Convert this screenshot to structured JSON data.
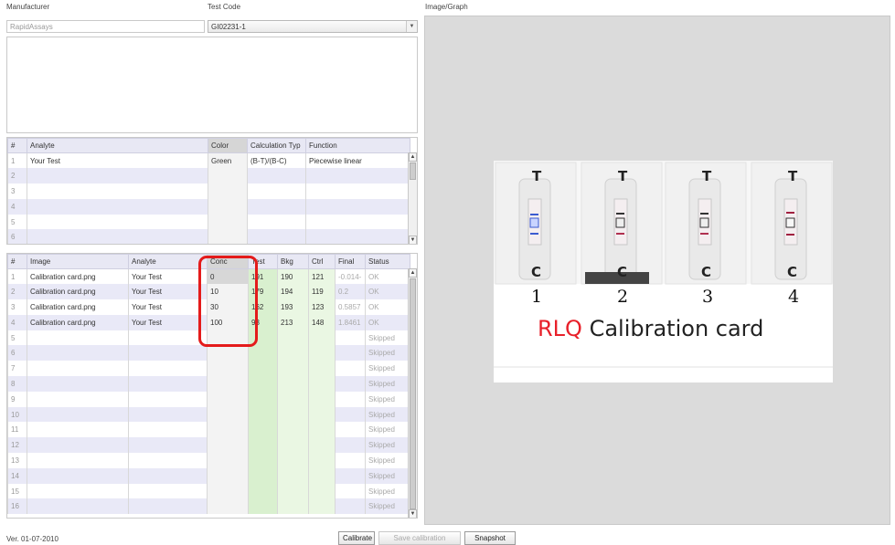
{
  "form": {
    "manufacturer_label": "Manufacturer",
    "manufacturer_value": "RapidAssays",
    "test_code_label": "Test Code",
    "test_code_value": "GI02231-1",
    "image_graph_label": "Image/Graph"
  },
  "analyte_table": {
    "headers": [
      "#",
      "Analyte",
      "Color",
      "Calculation Typ",
      "Function"
    ],
    "rows": [
      {
        "n": "1",
        "analyte": "Your Test",
        "color": "Green",
        "calc": "(B-T)/(B-C)",
        "func": "Piecewise linear"
      },
      {
        "n": "2"
      },
      {
        "n": "3"
      },
      {
        "n": "4"
      },
      {
        "n": "5"
      },
      {
        "n": "6"
      }
    ]
  },
  "image_table": {
    "headers": [
      "#",
      "Image",
      "Analyte",
      "Conc",
      "Test",
      "Bkg",
      "Ctrl",
      "Final",
      "Status"
    ],
    "rows": [
      {
        "n": "1",
        "image": "Calibration card.png",
        "analyte": "Your Test",
        "conc": "0",
        "test": "191",
        "bkg": "190",
        "ctrl": "121",
        "final": "-0.014-",
        "status": "OK"
      },
      {
        "n": "2",
        "image": "Calibration card.png",
        "analyte": "Your Test",
        "conc": "10",
        "test": "179",
        "bkg": "194",
        "ctrl": "119",
        "final": "0.2",
        "status": "OK"
      },
      {
        "n": "3",
        "image": "Calibration card.png",
        "analyte": "Your Test",
        "conc": "30",
        "test": "162",
        "bkg": "193",
        "ctrl": "123",
        "final": "0.5857",
        "status": "OK"
      },
      {
        "n": "4",
        "image": "Calibration card.png",
        "analyte": "Your Test",
        "conc": "100",
        "test": "93",
        "bkg": "213",
        "ctrl": "148",
        "final": "1.8461",
        "status": "OK"
      },
      {
        "n": "5",
        "status": "Skipped"
      },
      {
        "n": "6",
        "status": "Skipped"
      },
      {
        "n": "7",
        "status": "Skipped"
      },
      {
        "n": "8",
        "status": "Skipped"
      },
      {
        "n": "9",
        "status": "Skipped"
      },
      {
        "n": "10",
        "status": "Skipped"
      },
      {
        "n": "11",
        "status": "Skipped"
      },
      {
        "n": "12",
        "status": "Skipped"
      },
      {
        "n": "13",
        "status": "Skipped"
      },
      {
        "n": "14",
        "status": "Skipped"
      },
      {
        "n": "15",
        "status": "Skipped"
      },
      {
        "n": "16",
        "status": "Skipped"
      }
    ]
  },
  "calibration_card": {
    "strip_numbers": [
      "1",
      "2",
      "3",
      "4"
    ],
    "title_red": "RLQ",
    "title_rest": " Calibration card",
    "strip_top_letter": "T",
    "strip_bottom_letter": "C"
  },
  "footer": {
    "version": "Ver. 01-07-2010",
    "calibrate_label": "Calibrate",
    "save_calibration_label": "Save calibration",
    "snapshot_label": "Snapshot"
  },
  "colors": {
    "highlight": "#e41b1b",
    "title_red": "#e8202a"
  }
}
